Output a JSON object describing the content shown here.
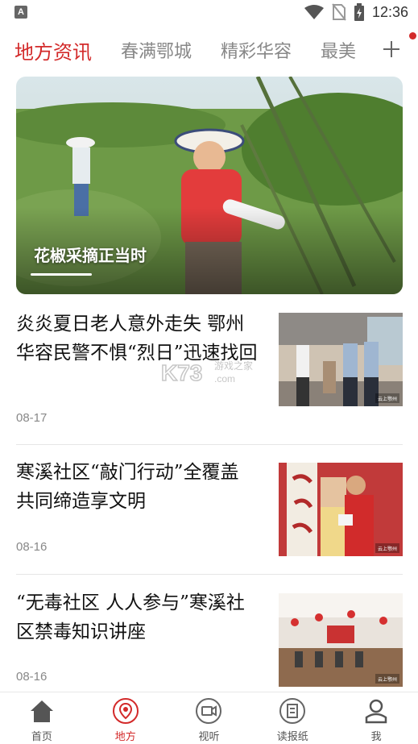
{
  "status_bar": {
    "app_badge": "A",
    "time": "12:36",
    "icons": [
      "wifi-icon",
      "no-sim-icon",
      "battery-charging-icon"
    ]
  },
  "tabs": [
    {
      "label": "地方资讯",
      "active": true
    },
    {
      "label": "春满鄂城",
      "active": false
    },
    {
      "label": "精彩华容",
      "active": false
    },
    {
      "label": "最美",
      "active": false
    }
  ],
  "add_tab_icon": "plus-icon",
  "banner": {
    "caption": "花椒采摘正当时"
  },
  "news": [
    {
      "title": "炎炎夏日老人意外走失 鄂州华容民警不惧“烈日”迅速找回",
      "date": "08-17",
      "thumb_badge": "云上鄂州"
    },
    {
      "title": "寒溪社区“敲门行动”全覆盖 共同缔造享文明",
      "date": "08-16",
      "thumb_badge": "云上鄂州"
    },
    {
      "title": "“无毒社区 人人参与”寒溪社区禁毒知识讲座",
      "date": "08-16",
      "thumb_badge": "云上鄂州"
    }
  ],
  "watermark": {
    "brand": "K73",
    "sub": "游戏之家",
    "domain": ".com"
  },
  "bottom_nav": [
    {
      "label": "首页",
      "icon": "home-icon",
      "active": false
    },
    {
      "label": "地方",
      "icon": "location-icon",
      "active": true
    },
    {
      "label": "视听",
      "icon": "video-icon",
      "active": false
    },
    {
      "label": "读报纸",
      "icon": "newspaper-icon",
      "active": false
    },
    {
      "label": "我",
      "icon": "user-icon",
      "active": false
    }
  ],
  "colors": {
    "accent": "#d32a2a",
    "text": "#111111",
    "muted": "#888888"
  }
}
